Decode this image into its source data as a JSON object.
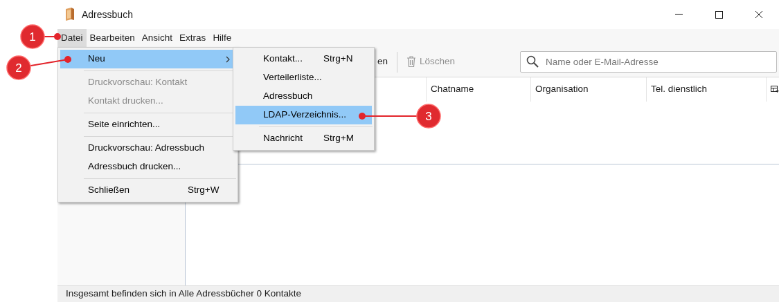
{
  "window": {
    "title": "Adressbuch"
  },
  "menubar": [
    {
      "label": "Datei",
      "open": true
    },
    {
      "label": "Bearbeiten",
      "open": false
    },
    {
      "label": "Ansicht",
      "open": false
    },
    {
      "label": "Extras",
      "open": false
    },
    {
      "label": "Hilfe",
      "open": false
    }
  ],
  "file_menu": [
    {
      "kind": "item",
      "label": "Neu",
      "has_submenu": true,
      "selected": true,
      "disabled": false
    },
    {
      "kind": "separator"
    },
    {
      "kind": "item",
      "label": "Druckvorschau: Kontakt",
      "selected": false,
      "disabled": true
    },
    {
      "kind": "item",
      "label": "Kontakt drucken...",
      "selected": false,
      "disabled": true
    },
    {
      "kind": "separator"
    },
    {
      "kind": "item",
      "label": "Seite einrichten...",
      "selected": false,
      "disabled": false
    },
    {
      "kind": "separator"
    },
    {
      "kind": "item",
      "label": "Druckvorschau: Adressbuch",
      "selected": false,
      "disabled": false
    },
    {
      "kind": "item",
      "label": "Adressbuch drucken...",
      "selected": false,
      "disabled": false
    },
    {
      "kind": "separator"
    },
    {
      "kind": "item",
      "label": "Schließen",
      "shortcut": "Strg+W",
      "selected": false,
      "disabled": false
    }
  ],
  "new_submenu": [
    {
      "kind": "item",
      "label": "Kontakt...",
      "shortcut": "Strg+N",
      "selected": false,
      "disabled": false
    },
    {
      "kind": "item",
      "label": "Verteilerliste...",
      "selected": false,
      "disabled": false
    },
    {
      "kind": "item",
      "label": "Adressbuch",
      "selected": false,
      "disabled": false
    },
    {
      "kind": "item",
      "label": "LDAP-Verzeichnis...",
      "selected": true,
      "disabled": false
    },
    {
      "kind": "separator"
    },
    {
      "kind": "item",
      "label": "Nachricht",
      "shortcut": "Strg+M",
      "selected": false,
      "disabled": false
    }
  ],
  "toolbar": [
    {
      "kind": "fragment",
      "label": "en"
    },
    {
      "kind": "separator"
    },
    {
      "kind": "delete",
      "label": "Löschen",
      "disabled": true
    }
  ],
  "search": {
    "placeholder": "Name oder E-Mail-Adresse"
  },
  "table": {
    "columns": [
      "Chatname",
      "Organisation",
      "Tel. dienstlich"
    ]
  },
  "status_bar": "Insgesamt befinden sich in Alle Adressbücher 0 Kontakte",
  "callouts": [
    "1",
    "2",
    "3"
  ]
}
